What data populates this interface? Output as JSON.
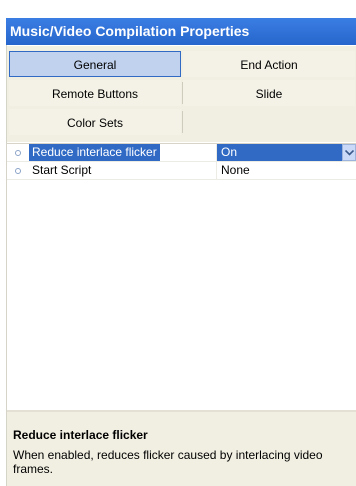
{
  "panel": {
    "title": "Music/Video Compilation Properties"
  },
  "tabs": [
    {
      "label": "General",
      "active": true
    },
    {
      "label": "End Action",
      "active": false
    },
    {
      "label": "Remote Buttons",
      "active": false
    },
    {
      "label": "Slide",
      "active": false
    },
    {
      "label": "Color Sets",
      "active": false
    }
  ],
  "properties": [
    {
      "name": "Reduce interlace flicker",
      "value": "On",
      "selected": true,
      "control": "dropdown"
    },
    {
      "name": "Start Script",
      "value": "None",
      "selected": false
    }
  ],
  "description": {
    "title": "Reduce interlace flicker",
    "text": "When enabled, reduces flicker caused by interlacing video frames."
  },
  "icons": {
    "bullet": "property-bullet-icon",
    "dropdown": "chevron-down-icon"
  },
  "colors": {
    "title_bar": "#2f72d8",
    "selection": "#316ac5",
    "active_tab": "#c1d2ee"
  }
}
